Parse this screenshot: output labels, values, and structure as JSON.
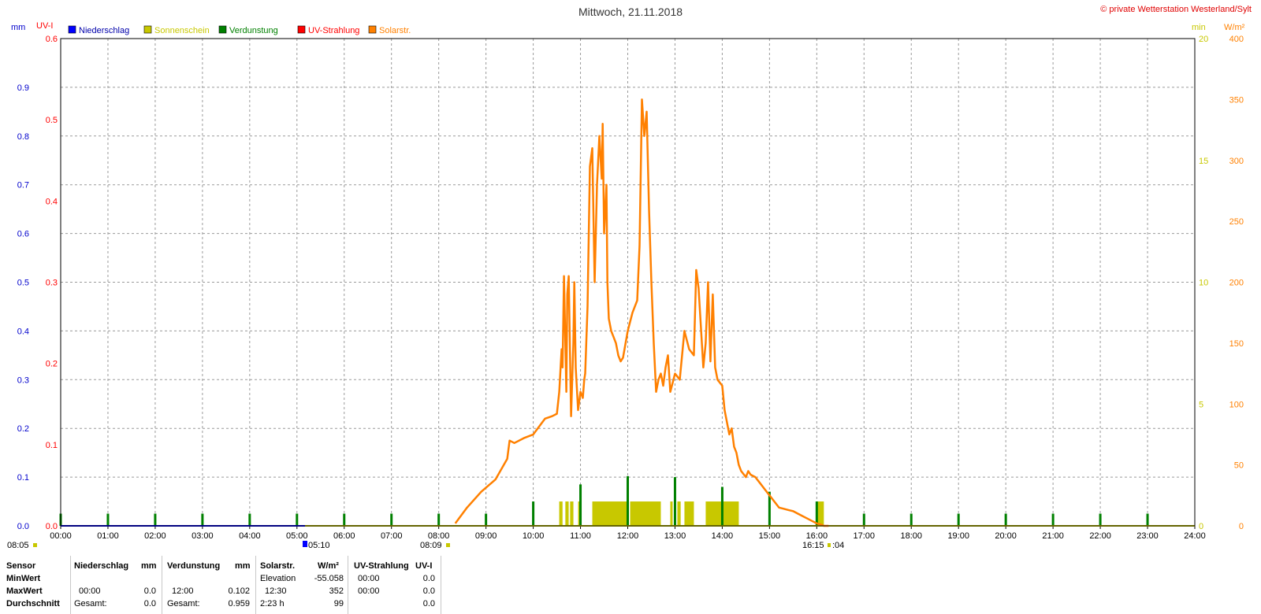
{
  "header": {
    "title": "Mittwoch, 21.11.2018",
    "copyright": "© private Wetterstation Westerland/Sylt"
  },
  "colors": {
    "niederschlag": "#0000ff",
    "sonnenschein": "#c8c800",
    "verdunstung": "#008000",
    "uv": "#ff0000",
    "solar": "#ff8000",
    "grid": "#9a9a9a"
  },
  "chart_data": {
    "type": "line",
    "title": "Mittwoch, 21.11.2018",
    "x_range": [
      "00:00",
      "24:00"
    ],
    "x_ticks": [
      "00:00",
      "01:00",
      "02:00",
      "03:00",
      "04:00",
      "05:00",
      "06:00",
      "07:00",
      "08:00",
      "09:00",
      "10:00",
      "11:00",
      "12:00",
      "13:00",
      "14:00",
      "15:00",
      "16:00",
      "17:00",
      "18:00",
      "19:00",
      "20:00",
      "21:00",
      "22:00",
      "23:00",
      "24:00"
    ],
    "grid": true,
    "legend_position": "top-left",
    "legend": [
      {
        "label": "Niederschlag",
        "color": "#0000ff"
      },
      {
        "label": "Sonnenschein",
        "color": "#c8c800"
      },
      {
        "label": "Verdunstung",
        "color": "#008000"
      },
      {
        "label": "UV-Strahlung",
        "color": "#ff0000"
      },
      {
        "label": "Solarstr.",
        "color": "#ff8000"
      }
    ],
    "axes": {
      "mm": {
        "label": "mm",
        "range": [
          0,
          1.0
        ],
        "ticks": [
          "0.0",
          "0.1",
          "0.2",
          "0.3",
          "0.4",
          "0.5",
          "0.6",
          "0.7",
          "0.8",
          "0.9"
        ],
        "color": "#0000cc"
      },
      "uv": {
        "label": "UV-I",
        "range": [
          0,
          0.6
        ],
        "ticks": [
          "0.0",
          "0.1",
          "0.2",
          "0.3",
          "0.4",
          "0.5",
          "0.6"
        ],
        "color": "#ff0000"
      },
      "min": {
        "label": "min",
        "range": [
          0,
          20
        ],
        "ticks": [
          "0",
          "5",
          "10",
          "15",
          "20"
        ],
        "color": "#c8c800"
      },
      "wm2": {
        "label": "W/m²",
        "range": [
          0,
          400
        ],
        "ticks": [
          "0",
          "50",
          "100",
          "150",
          "200",
          "250",
          "300",
          "350",
          "400"
        ],
        "color": "#ff8000"
      }
    },
    "series": [
      {
        "name": "Solarstr.",
        "axis": "wm2",
        "x_hours": [
          8.35,
          8.6,
          8.9,
          9.2,
          9.45,
          9.5,
          9.6,
          9.8,
          10.0,
          10.25,
          10.4,
          10.5,
          10.55,
          10.6,
          10.62,
          10.65,
          10.7,
          10.72,
          10.75,
          10.8,
          10.85,
          10.87,
          10.9,
          10.95,
          11.0,
          11.05,
          11.08,
          11.1,
          11.15,
          11.2,
          11.25,
          11.3,
          11.35,
          11.4,
          11.45,
          11.47,
          11.5,
          11.55,
          11.57,
          11.6,
          11.65,
          11.7,
          11.75,
          11.8,
          11.85,
          11.9,
          12.0,
          12.1,
          12.2,
          12.25,
          12.3,
          12.35,
          12.4,
          12.45,
          12.5,
          12.55,
          12.6,
          12.65,
          12.7,
          12.75,
          12.8,
          12.85,
          12.9,
          13.0,
          13.1,
          13.2,
          13.3,
          13.4,
          13.45,
          13.5,
          13.6,
          13.65,
          13.7,
          13.75,
          13.8,
          13.85,
          13.9,
          14.0,
          14.05,
          14.1,
          14.15,
          14.2,
          14.25,
          14.3,
          14.35,
          14.4,
          14.5,
          14.55,
          14.6,
          14.7,
          14.8,
          14.9,
          15.0,
          15.1,
          15.2,
          15.3,
          15.4,
          15.5,
          15.6,
          15.7,
          15.8,
          15.9,
          16.0,
          16.1,
          16.15,
          16.25
        ],
        "values": [
          2,
          15,
          28,
          38,
          55,
          70,
          68,
          72,
          75,
          88,
          90,
          92,
          110,
          145,
          130,
          205,
          110,
          190,
          205,
          90,
          150,
          200,
          130,
          95,
          110,
          105,
          120,
          125,
          180,
          295,
          310,
          200,
          280,
          320,
          285,
          330,
          240,
          280,
          200,
          170,
          160,
          155,
          150,
          140,
          135,
          138,
          160,
          175,
          185,
          230,
          350,
          320,
          340,
          260,
          200,
          150,
          110,
          120,
          125,
          115,
          130,
          140,
          110,
          125,
          120,
          160,
          145,
          140,
          210,
          195,
          130,
          150,
          200,
          135,
          190,
          130,
          120,
          115,
          95,
          85,
          75,
          80,
          65,
          60,
          50,
          45,
          40,
          45,
          42,
          40,
          35,
          30,
          25,
          20,
          15,
          14,
          13,
          12,
          10,
          8,
          6,
          4,
          2,
          1,
          0,
          0
        ],
        "color": "#ff8000"
      },
      {
        "name": "Verdunstung",
        "axis": "mm",
        "x_hours": [
          0,
          1,
          2,
          3,
          4,
          5,
          6,
          7,
          8,
          9,
          10,
          11,
          12,
          13,
          14,
          15,
          16,
          17,
          18,
          19,
          20,
          21,
          22,
          23
        ],
        "values": [
          0.025,
          0.025,
          0.025,
          0.025,
          0.025,
          0.025,
          0.025,
          0.025,
          0.025,
          0.025,
          0.05,
          0.085,
          0.102,
          0.1,
          0.08,
          0.07,
          0.05,
          0.025,
          0.025,
          0.025,
          0.025,
          0.025,
          0.025,
          0.025
        ],
        "color": "#008000"
      },
      {
        "name": "Sonnenschein",
        "axis": "min",
        "intervals": [
          [
            10.55,
            10.62
          ],
          [
            10.68,
            10.75
          ],
          [
            10.78,
            10.85
          ],
          [
            10.95,
            11.0
          ],
          [
            11.25,
            12.0
          ],
          [
            12.05,
            12.7
          ],
          [
            12.9,
            12.95
          ],
          [
            13.05,
            13.12
          ],
          [
            13.2,
            13.4
          ],
          [
            13.65,
            14.35
          ],
          [
            16.0,
            16.15
          ]
        ],
        "values": [
          1,
          1,
          1,
          1,
          1,
          1,
          1,
          1,
          1,
          1,
          1
        ],
        "color": "#c8c800"
      },
      {
        "name": "Niederschlag",
        "axis": "mm",
        "x_range": [
          "00:00",
          "24:00"
        ],
        "values": [
          0,
          0
        ],
        "color": "#0000ff"
      },
      {
        "name": "UV-Strahlung",
        "axis": "uv",
        "x_range": [
          "00:00",
          "24:00"
        ],
        "values": [
          0,
          0
        ],
        "color": "#ff0000"
      }
    ],
    "markers": {
      "left": "08:05",
      "sunrise_mark": "05:10",
      "sunrise_solar": "08:09",
      "sunset": "16:15",
      "sunset_extra": ":04"
    }
  },
  "stats": {
    "headers": {
      "sensor": "Sensor",
      "niederschlag": "Niederschlag",
      "mm1": "mm",
      "verdunstung": "Verdunstung",
      "mm2": "mm",
      "solar": "Solarstr.",
      "wm2": "W/m²",
      "uv": "UV-Strahlung",
      "uvi": "UV-I"
    },
    "rows": [
      {
        "label": "MinWert",
        "n_time": "",
        "n_val": "",
        "v_time": "",
        "v_val": "",
        "s_time": "Elevation",
        "s_val": "-55.058",
        "u_time": "00:00",
        "u_val": "0.0"
      },
      {
        "label": "MaxWert",
        "n_time": "00:00",
        "n_val": "0.0",
        "v_time": "12:00",
        "v_val": "0.102",
        "s_time": "12:30",
        "s_val": "352",
        "u_time": "00:00",
        "u_val": "0.0"
      },
      {
        "label": "Durchschnitt",
        "n_time": "Gesamt:",
        "n_val": "0.0",
        "v_time": "Gesamt:",
        "v_val": "0.959",
        "s_time": "2:23 h",
        "s_val": "99",
        "u_time": "",
        "u_val": "0.0"
      }
    ]
  }
}
